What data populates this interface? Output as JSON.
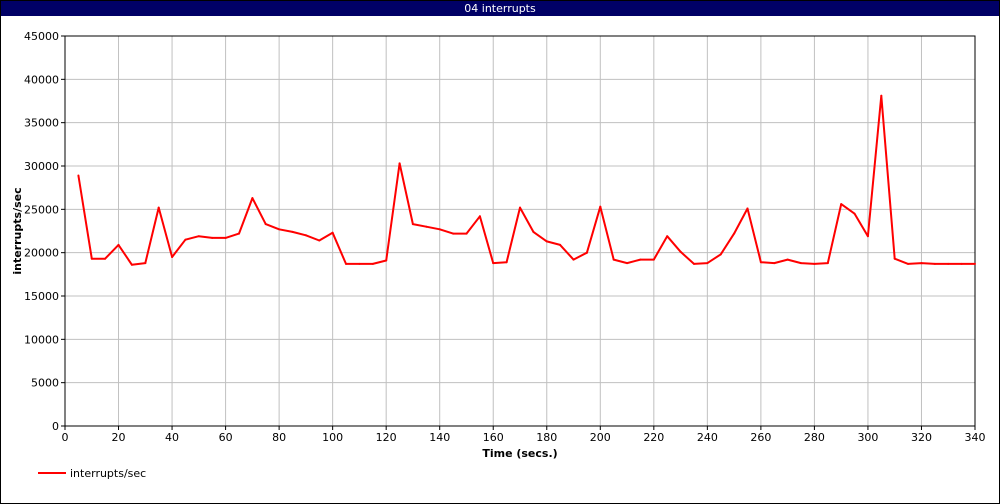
{
  "window": {
    "title": "04 interrupts",
    "title_bar_color": "#000066"
  },
  "chart_data": {
    "type": "line",
    "title": "",
    "xlabel": "Time (secs.)",
    "ylabel": "interrupts/sec",
    "xlim": [
      0,
      340
    ],
    "ylim": [
      0,
      45000
    ],
    "xticks": [
      0,
      20,
      40,
      60,
      80,
      100,
      120,
      140,
      160,
      180,
      200,
      220,
      240,
      260,
      280,
      300,
      320,
      340
    ],
    "yticks": [
      0,
      5000,
      10000,
      15000,
      20000,
      25000,
      30000,
      35000,
      40000,
      45000
    ],
    "grid": true,
    "legend_position": "bottom-left",
    "series": [
      {
        "name": "interrupts/sec",
        "color": "#ff0000",
        "x": [
          5,
          10,
          15,
          20,
          25,
          30,
          35,
          40,
          45,
          50,
          55,
          60,
          65,
          70,
          75,
          80,
          85,
          90,
          95,
          100,
          105,
          110,
          115,
          120,
          125,
          130,
          135,
          140,
          145,
          150,
          155,
          160,
          165,
          170,
          175,
          180,
          185,
          190,
          195,
          200,
          205,
          210,
          215,
          220,
          225,
          230,
          235,
          240,
          245,
          250,
          255,
          260,
          265,
          270,
          275,
          280,
          285,
          290,
          295,
          300,
          305,
          310,
          315,
          320,
          325,
          330,
          335,
          340
        ],
        "y": [
          28900,
          19300,
          19300,
          20900,
          18600,
          18800,
          25200,
          19500,
          21500,
          21900,
          21700,
          21700,
          22200,
          26300,
          23300,
          22700,
          22400,
          22000,
          21400,
          22300,
          18700,
          18700,
          18700,
          19100,
          30300,
          23300,
          23000,
          22700,
          22200,
          22200,
          24200,
          18800,
          18900,
          25200,
          22400,
          21300,
          20900,
          19200,
          20000,
          25300,
          19200,
          18800,
          19200,
          19200,
          21900,
          20100,
          18700,
          18800,
          19800,
          22200,
          25100,
          18900,
          18800,
          19200,
          18800,
          18700,
          18800,
          25600,
          24500,
          21900,
          38100,
          19300,
          18700,
          18800,
          18700,
          18700,
          18700,
          18700
        ]
      }
    ]
  }
}
